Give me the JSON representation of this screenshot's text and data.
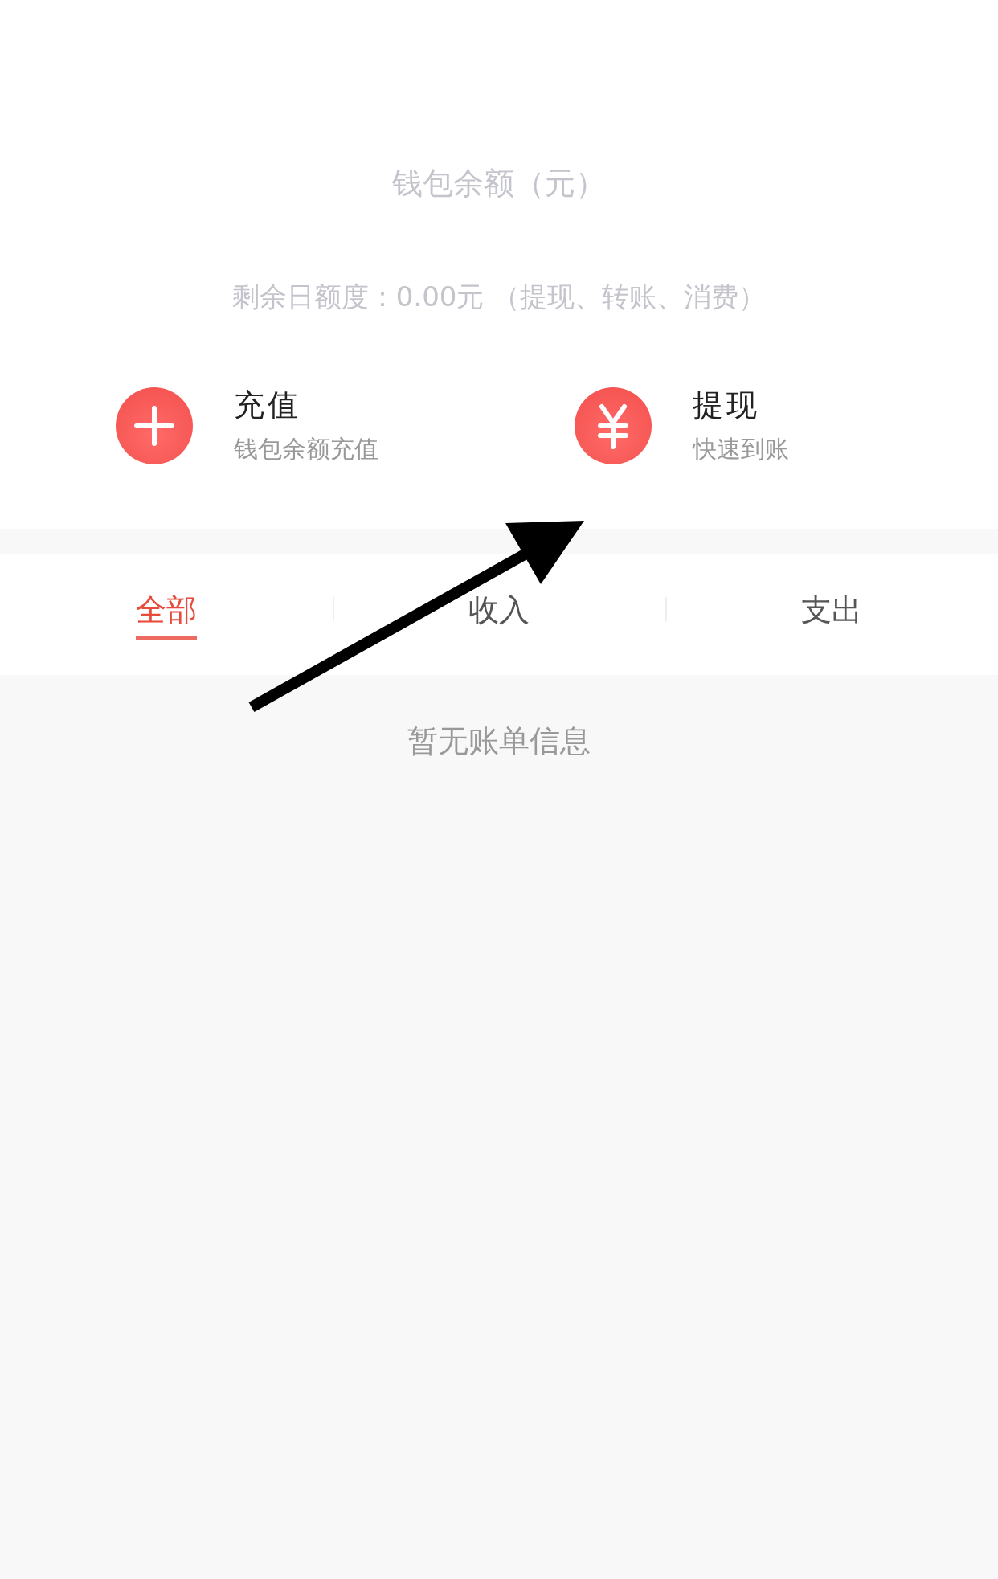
{
  "wallet": {
    "balance_label": "钱包余额（元）",
    "quota_text": "剩余日额度：0.00元 （提现、转账、消费）"
  },
  "actions": [
    {
      "kind": "plus",
      "title": "充值",
      "subtitle": "钱包余额充值"
    },
    {
      "kind": "yuan",
      "title": "提现",
      "subtitle": "快速到账"
    }
  ],
  "tabs": [
    {
      "label": "全部",
      "selected": true
    },
    {
      "label": "收入",
      "selected": false
    },
    {
      "label": "支出",
      "selected": false
    }
  ],
  "empty_message": "暂无账单信息"
}
